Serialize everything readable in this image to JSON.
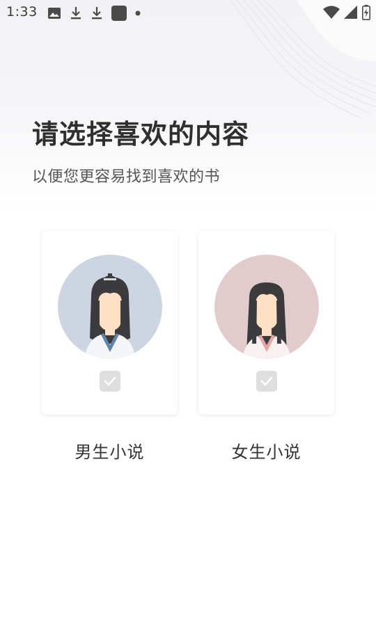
{
  "status_bar": {
    "time": "1:33",
    "left_icons": [
      "image-icon",
      "download-icon",
      "download-icon",
      "app-icon",
      "dot-icon"
    ],
    "right_icons": [
      "wifi-icon",
      "signal-icon",
      "battery-charging-icon"
    ]
  },
  "header": {
    "title": "请选择喜欢的内容",
    "subtitle": "以便您更容易找到喜欢的书"
  },
  "options": [
    {
      "label": "男生小说",
      "avatar": "male-avatar",
      "checked": false,
      "avatar_bg": "#cdd4e2"
    },
    {
      "label": "女生小说",
      "avatar": "female-avatar",
      "checked": false,
      "avatar_bg": "#e2cbcc"
    }
  ],
  "colors": {
    "check_bg": "#dedede",
    "title": "#2f2f2f"
  }
}
